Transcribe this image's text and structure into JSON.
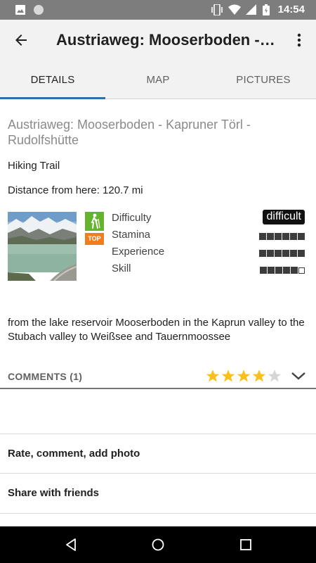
{
  "status_bar": {
    "time": "14:54",
    "icons": [
      "image-icon",
      "circle-icon",
      "vibrate-icon",
      "wifi-icon",
      "signal-icon",
      "battery-icon"
    ]
  },
  "app_bar": {
    "title": "Austriaweg: Mooserboden - K...",
    "back_icon": "arrow-left-icon",
    "menu_icon": "more-vert-icon"
  },
  "tabs": [
    {
      "label": "DETAILS",
      "active": true
    },
    {
      "label": "MAP",
      "active": false
    },
    {
      "label": "PICTURES",
      "active": false
    }
  ],
  "details": {
    "full_title": "Austriaweg: Mooserboden - Kapruner Törl - Rudolfshütte",
    "type": "Hiking Trail",
    "distance": "Distance from here: 120.7 mi",
    "badges": {
      "hike_icon": "hiker-icon",
      "top_label": "TOP"
    },
    "ratings": [
      {
        "label": "Difficulty",
        "value_text": "difficult"
      },
      {
        "label": "Stamina",
        "level": 6,
        "max": 6
      },
      {
        "label": "Experience",
        "level": 6,
        "max": 6
      },
      {
        "label": "Skill",
        "level": 5,
        "max": 6
      }
    ],
    "description": "from the lake reservoir Mooserboden in the Kaprun valley to the Stubach valley to Weißsee and Tauernmoossee"
  },
  "comments": {
    "label": "COMMENTS (1)",
    "stars": 4,
    "max_stars": 5
  },
  "actions": {
    "rate": "Rate, comment, add photo",
    "share": "Share with friends"
  },
  "colors": {
    "accent": "#2e6fb0",
    "hike_green": "#64b42d",
    "top_orange": "#f07d1e",
    "star_yellow": "#f9c11a",
    "star_empty": "#d6d6d6"
  }
}
